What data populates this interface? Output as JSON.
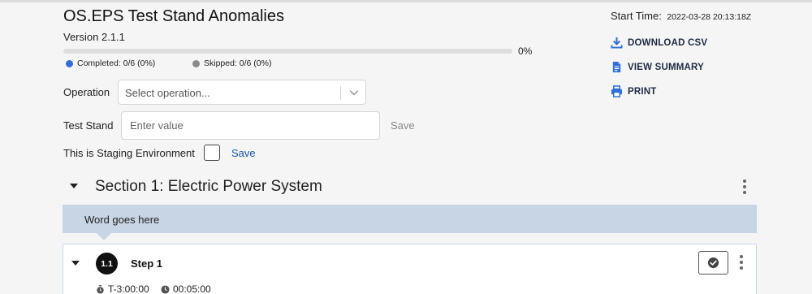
{
  "header": {
    "title": "OS.EPS Test Stand Anomalies",
    "version": "Version 2.1.1",
    "start_time_label": "Start Time:",
    "start_time_value": "2022-03-28 20:13:18Z"
  },
  "progress": {
    "percent_text": "0%",
    "fraction": 0,
    "completed_text": "Completed: 0/6 (0%)",
    "skipped_text": "Skipped: 0/6 (0%)",
    "completed_color": "#2f6fd6",
    "skipped_color": "#8a8a8a"
  },
  "form": {
    "operation_label": "Operation",
    "operation_placeholder": "Select operation...",
    "test_stand_label": "Test Stand",
    "test_stand_placeholder": "Enter value",
    "test_stand_save": "Save",
    "staging_label": "This is Staging Environment",
    "staging_save": "Save"
  },
  "actions": [
    {
      "label": "DOWNLOAD CSV",
      "icon": "download-icon"
    },
    {
      "label": "VIEW SUMMARY",
      "icon": "document-icon"
    },
    {
      "label": "PRINT",
      "icon": "printer-icon"
    }
  ],
  "section": {
    "title": "Section 1: Electric Power System",
    "banner_text": "Word goes here"
  },
  "step": {
    "number": "1.1",
    "title": "Step 1",
    "t_minus": "T-3:00:00",
    "duration": "00:05:00"
  },
  "colors": {
    "accent_blue": "#1a56b0",
    "banner_bg": "#c7d5e4",
    "action_icon": "#2f6fd6"
  }
}
